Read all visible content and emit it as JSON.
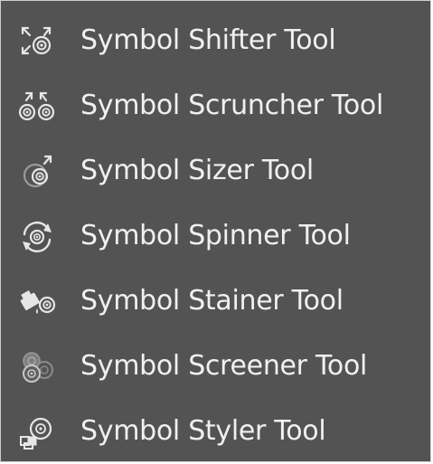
{
  "menu": {
    "items": [
      {
        "label": "Symbol Shifter Tool",
        "icon": "symbol-shifter-icon"
      },
      {
        "label": "Symbol Scruncher Tool",
        "icon": "symbol-scruncher-icon"
      },
      {
        "label": "Symbol Sizer Tool",
        "icon": "symbol-sizer-icon"
      },
      {
        "label": "Symbol Spinner Tool",
        "icon": "symbol-spinner-icon"
      },
      {
        "label": "Symbol Stainer Tool",
        "icon": "symbol-stainer-icon"
      },
      {
        "label": "Symbol Screener Tool",
        "icon": "symbol-screener-icon"
      },
      {
        "label": "Symbol Styler Tool",
        "icon": "symbol-styler-icon"
      }
    ]
  },
  "colors": {
    "panel_background": "#535353",
    "text": "#f0f0f0",
    "icon": "#e6e6e6",
    "icon_dim": "#9a9a9a"
  }
}
